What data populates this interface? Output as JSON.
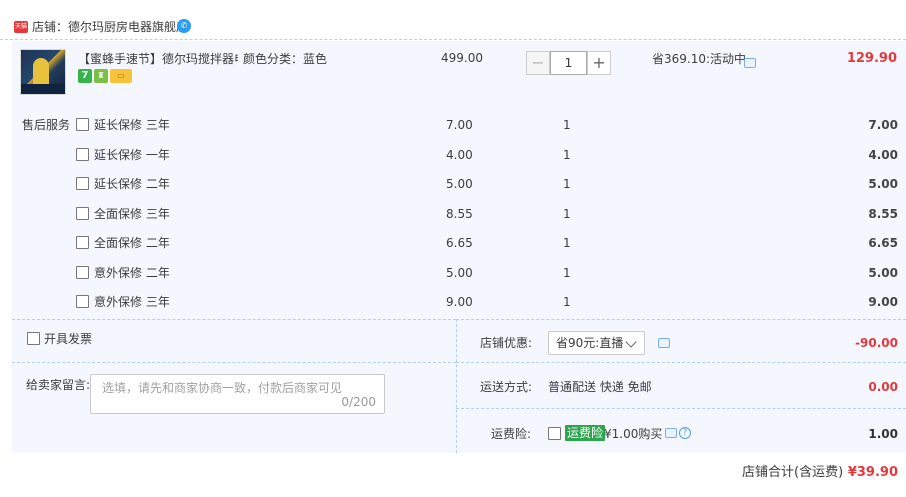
{
  "shop": {
    "badge": "天猫",
    "label": "店铺：",
    "name": "德尔玛厨房电器旗舰店"
  },
  "item": {
    "title": "【蜜蜂手速节】德尔玛搅拌器电...",
    "sku": "颜色分类：蓝色",
    "unit_price": "499.00",
    "quantity": "1",
    "qty_minus": "−",
    "qty_plus": "+",
    "discount_note": "省369.10:活动中",
    "total": "129.90",
    "tag_7": "7"
  },
  "services": {
    "label": "售后服务",
    "rows": [
      {
        "name": "延长保修 三年",
        "price": "7.00",
        "qty": "1",
        "total": "7.00"
      },
      {
        "name": "延长保修 一年",
        "price": "4.00",
        "qty": "1",
        "total": "4.00"
      },
      {
        "name": "延长保修 二年",
        "price": "5.00",
        "qty": "1",
        "total": "5.00"
      },
      {
        "name": "全面保修 三年",
        "price": "8.55",
        "qty": "1",
        "total": "8.55"
      },
      {
        "name": "全面保修 二年",
        "price": "6.65",
        "qty": "1",
        "total": "6.65"
      },
      {
        "name": "意外保修 二年",
        "price": "5.00",
        "qty": "1",
        "total": "5.00"
      },
      {
        "name": "意外保修 三年",
        "price": "9.00",
        "qty": "1",
        "total": "9.00"
      }
    ]
  },
  "invoice": {
    "label": "开具发票"
  },
  "message": {
    "label": "给卖家留言:",
    "placeholder": "选填，请先和商家协商一致，付款后商家可见",
    "counter": "0/200"
  },
  "shop_discount": {
    "label": "店铺优惠:",
    "selected": "省90元:直播",
    "value": "-90.00"
  },
  "shipping": {
    "label": "运送方式:",
    "method": "普通配送 快递 免邮",
    "value": "0.00"
  },
  "insurance": {
    "label": "运费险:",
    "badge": "运费险",
    "offer": "¥1.00购买",
    "help": "?",
    "value": "1.00"
  },
  "footer": {
    "label": "店铺合计(含运费)",
    "total": "¥39.90"
  },
  "colors": {
    "accent_red": "#e4393c",
    "panel_bg": "#f4f8fe",
    "insurance_green": "#2da44e"
  }
}
